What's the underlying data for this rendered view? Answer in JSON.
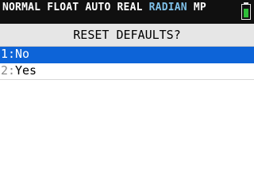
{
  "status_bar": {
    "mode_normal": "NORMAL",
    "mode_float": "FLOAT",
    "mode_auto": "AUTO",
    "mode_real": "REAL",
    "mode_angle": "RADIAN",
    "mode_mp": "MP",
    "battery_level": 0.8,
    "colors": {
      "background": "#101010",
      "text": "#ffffff",
      "accent": "#7fc0e8",
      "battery": "#2fbf3a"
    }
  },
  "dialog": {
    "title": "RESET DEFAULTS?"
  },
  "menu": {
    "items": [
      {
        "number": "1",
        "label": "No",
        "selected": true
      },
      {
        "number": "2",
        "label": "Yes",
        "selected": false
      }
    ],
    "selection_color": "#0d64d8"
  }
}
